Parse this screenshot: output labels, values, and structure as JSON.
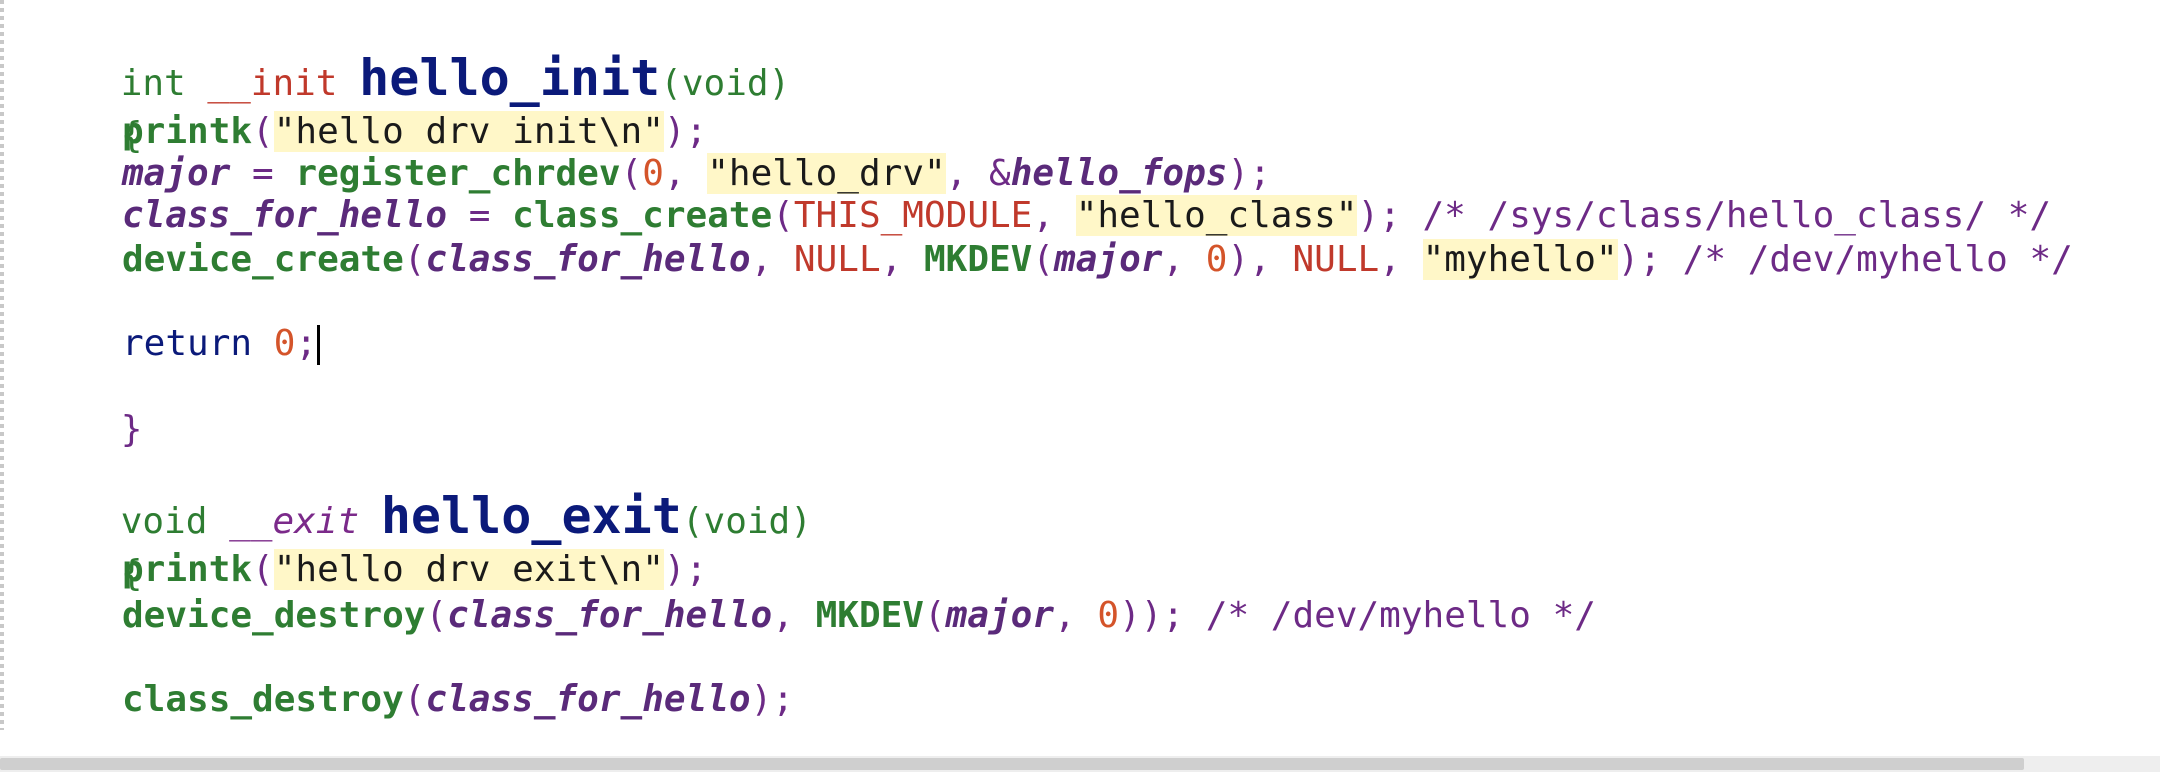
{
  "code": {
    "l1": {
      "type": "int",
      "mod": "__init",
      "name": "hello_init",
      "args": "(void)"
    },
    "l2": {
      "brace": "{"
    },
    "l3": {
      "fn": "printk",
      "open": "(",
      "str": "\"hello drv init\\n\"",
      "close": ");"
    },
    "l4": {
      "var": "major",
      "eq": " = ",
      "fn": "register_chrdev",
      "open": "(",
      "num": "0",
      "sep1": ", ",
      "str": "\"hello_drv\"",
      "sep2": ", &",
      "var2": "hello_fops",
      "close": ");"
    },
    "l5": {
      "var": "class_for_hello",
      "eq": " = ",
      "fn": "class_create",
      "open": "(",
      "const": "THIS_MODULE",
      "sep": ", ",
      "str": "\"hello_class\"",
      "close": ");",
      "comment": " /* /sys/class/hello_class/ */"
    },
    "l6": {
      "fn": "device_create",
      "open": "(",
      "var": "class_for_hello",
      "sep1": ", ",
      "const1": "NULL",
      "sep2": ", ",
      "fn2": "MKDEV",
      "open2": "(",
      "var2": "major",
      "sep3": ", ",
      "num": "0",
      "close2": "), ",
      "const2": "NULL",
      "sep4": ", ",
      "str": "\"myhello\"",
      "close": ");",
      "comment": " /* /dev/myhello */"
    },
    "l7": {
      "kw": "return",
      "sp": " ",
      "num": "0",
      "semi": ";"
    },
    "l8": {
      "brace": "}"
    },
    "l9": {
      "type": "void",
      "mod": "__exit",
      "name": "hello_exit",
      "args": "(void)"
    },
    "l10": {
      "brace": "{"
    },
    "l11": {
      "fn": "printk",
      "open": "(",
      "str": "\"hello drv exit\\n\"",
      "close": ");"
    },
    "l12": {
      "fn": "device_destroy",
      "open": "(",
      "var": "class_for_hello",
      "sep1": ", ",
      "fn2": "MKDEV",
      "open2": "(",
      "var2": "major",
      "sep2": ", ",
      "num": "0",
      "close": "));",
      "comment": " /* /dev/myhello */"
    },
    "l13": {
      "fn": "class_destroy",
      "open": "(",
      "var": "class_for_hello",
      "close": ");"
    }
  },
  "colors": {
    "keyword_type": "#2e7d32",
    "function": "#2e7d32",
    "function_name_large": "#0b1a7a",
    "variable": "#5a2a7a",
    "number": "#d4542a",
    "constant": "#c0392b",
    "string_background": "#fff7c8",
    "comment": "#6d2a86"
  }
}
